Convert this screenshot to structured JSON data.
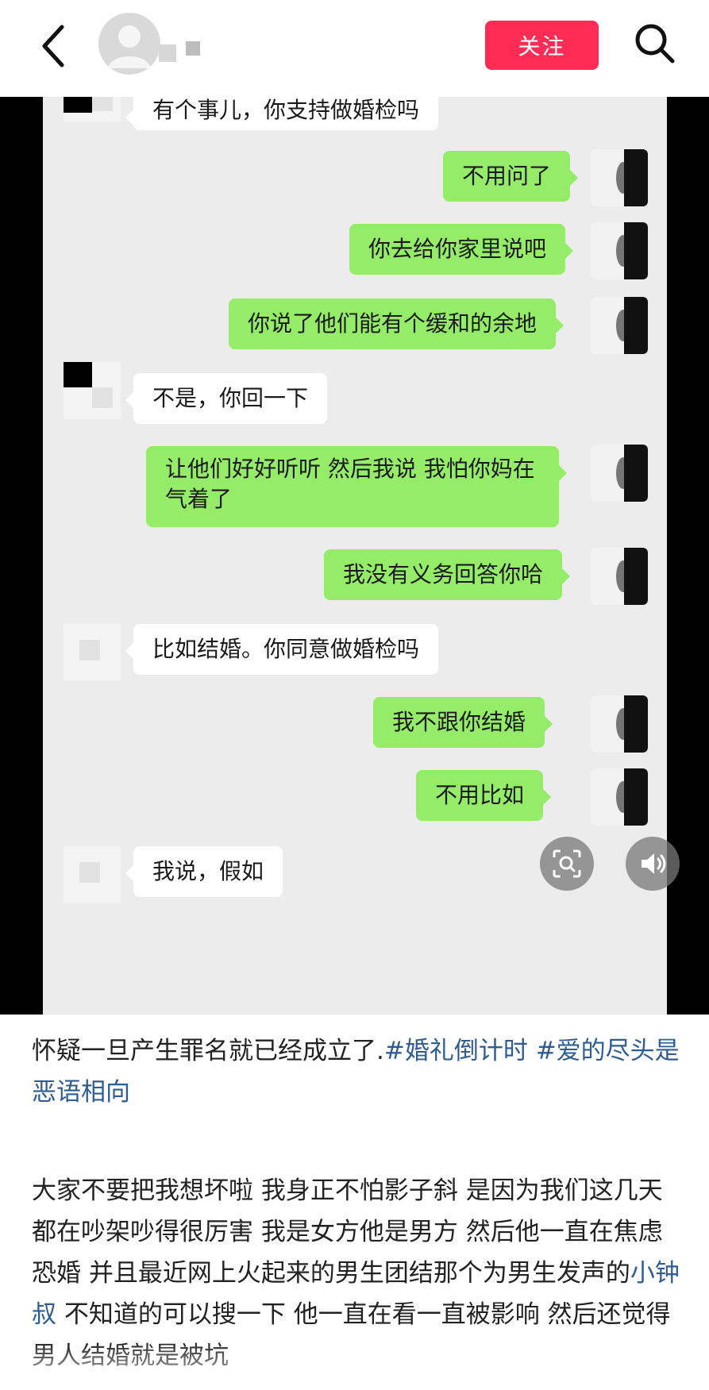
{
  "header": {
    "follow_label": "关注",
    "icons": {
      "back": "chevron-left-icon",
      "search": "search-icon",
      "avatar": "user-avatar-icon"
    },
    "accent": "#fe2c55"
  },
  "chat": {
    "bubble_out_color": "#95ec69",
    "bubble_in_color": "#ffffff",
    "messages": [
      {
        "side": "in",
        "text": "有个事儿，你支持做婚检吗"
      },
      {
        "side": "out",
        "text": "不用问了"
      },
      {
        "side": "out",
        "text": "你去给你家里说吧"
      },
      {
        "side": "out",
        "text": "你说了他们能有个缓和的余地"
      },
      {
        "side": "in",
        "text": "不是，你回一下"
      },
      {
        "side": "out",
        "text": "让他们好好听听 然后我说 我怕你妈在气着了"
      },
      {
        "side": "out",
        "text": "我没有义务回答你哈"
      },
      {
        "side": "in",
        "text": "比如结婚。你同意做婚检吗"
      },
      {
        "side": "out",
        "text": "我不跟你结婚"
      },
      {
        "side": "out",
        "text": "不用比如"
      },
      {
        "side": "in",
        "text": "我说，假如"
      }
    ],
    "overlay_icons": [
      "image-search-icon",
      "volume-icon"
    ]
  },
  "caption": {
    "text": "怀疑一旦产生罪名就已经成立了.",
    "tags": [
      "#婚礼倒计时",
      "#爱的尽头是恶语相向"
    ]
  },
  "body": {
    "part1": "大家不要把我想坏啦 我身正不怕影子斜 是因为我们这几天都在吵架吵得很厉害 我是女方他是男方 然后他一直在焦虑恐婚 并且最近网上火起来的男生团结那个为男生发声的",
    "link": "小钟叔",
    "part2": " 不知道的可以搜一下 他一直在看一直被影响 然后还觉得男人结婚就是被坑"
  }
}
